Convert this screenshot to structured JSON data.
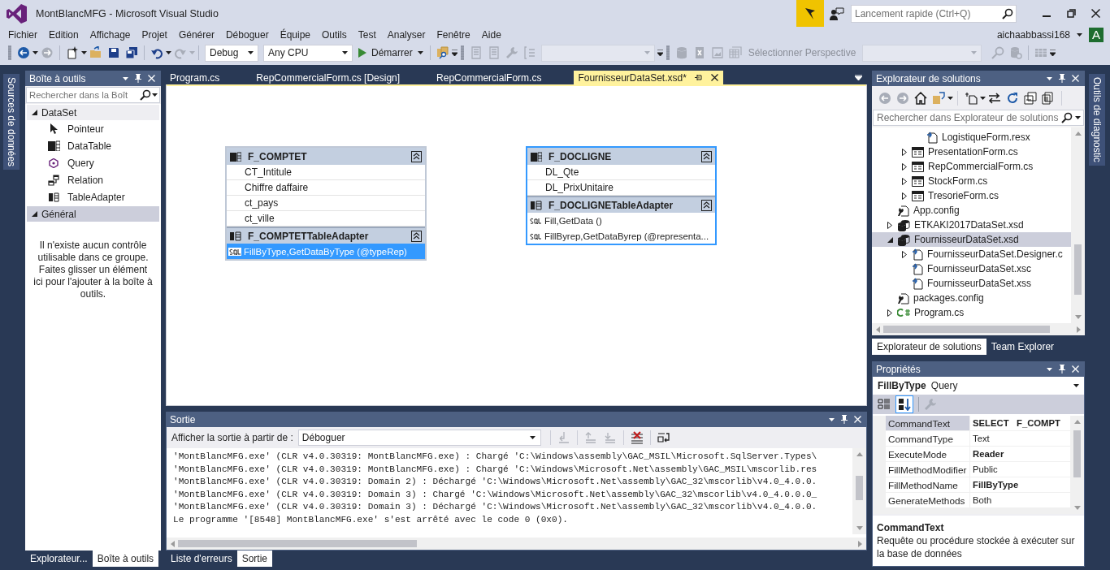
{
  "window": {
    "title": "MontBlancMFG - Microsoft Visual Studio"
  },
  "quick_launch": {
    "placeholder": "Lancement rapide (Ctrl+Q)"
  },
  "menu": [
    "Fichier",
    "Edition",
    "Affichage",
    "Projet",
    "Générer",
    "Déboguer",
    "Équipe",
    "Outils",
    "Test",
    "Analyser",
    "Fenêtre",
    "Aide"
  ],
  "account": {
    "user": "aichaabbassi168",
    "initial": "A"
  },
  "toolbar": {
    "configuration": "Debug",
    "platform": "Any CPU",
    "start": "Démarrer",
    "perspective": "Sélectionner Perspective"
  },
  "side_tabs": {
    "left": "Sources de données",
    "right": "Outils de diagnostic"
  },
  "toolbox": {
    "title": "Boîte à outils",
    "search": {
      "placeholder": "Rechercher dans la Boît"
    },
    "groups": [
      {
        "label": "DataSet",
        "expanded": true,
        "selected": false,
        "items": [
          {
            "label": "Pointeur",
            "kind": "pointer"
          },
          {
            "label": "DataTable",
            "kind": "datatable"
          },
          {
            "label": "Query",
            "kind": "query"
          },
          {
            "label": "Relation",
            "kind": "relation"
          },
          {
            "label": "TableAdapter",
            "kind": "tableadapter"
          }
        ]
      },
      {
        "label": "Général",
        "expanded": true,
        "selected": true,
        "empty_message": "Il n'existe aucun contrôle utilisable dans ce groupe. Faites glisser un élément ici pour l'ajouter à la boîte à outils."
      }
    ],
    "tabs": [
      {
        "label": "Explorateur...",
        "selected": false
      },
      {
        "label": "Boîte à outils",
        "selected": true
      }
    ]
  },
  "documents": {
    "tabs": [
      {
        "label": "Program.cs",
        "selected": false
      },
      {
        "label": "RepCommercialForm.cs [Design]",
        "selected": false
      },
      {
        "label": "RepCommercialForm.cs",
        "selected": false
      },
      {
        "label": "FournisseurDataSet.xsd*",
        "selected": true
      }
    ]
  },
  "designer": {
    "tables": [
      {
        "name": "F_COMPTET",
        "selected": false,
        "columns": [
          "CT_Intitule",
          "Chiffre daffaire",
          "ct_pays",
          "ct_ville"
        ],
        "adapter": {
          "name": "F_COMPTETTableAdapter",
          "queries": [
            {
              "text": "FillByType,GetDataByType (@typeRep)",
              "selected": true
            }
          ]
        }
      },
      {
        "name": "F_DOCLIGNE",
        "selected": true,
        "columns": [
          "DL_Qte",
          "DL_PrixUnitaire"
        ],
        "adapter": {
          "name": "F_DOCLIGNETableAdapter",
          "queries": [
            {
              "text": "Fill,GetData ()",
              "selected": false
            },
            {
              "text": "FillByrep,GetDataByrep (@representa...",
              "selected": false
            }
          ]
        }
      }
    ]
  },
  "output": {
    "title": "Sortie",
    "source_label": "Afficher la sortie à partir de :",
    "source": "Déboguer",
    "lines": [
      "'MontBlancMFG.exe' (CLR v4.0.30319: MontBlancMFG.exe) : Chargé 'C:\\Windows\\assembly\\GAC_MSIL\\Microsoft.SqlServer.Types\\",
      "'MontBlancMFG.exe' (CLR v4.0.30319: MontBlancMFG.exe) : Chargé 'C:\\Windows\\Microsoft.Net\\assembly\\GAC_MSIL\\mscorlib.res",
      "'MontBlancMFG.exe' (CLR v4.0.30319: Domain 2) : Déchargé 'C:\\Windows\\Microsoft.Net\\assembly\\GAC_32\\mscorlib\\v4.0_4.0.0.",
      "'MontBlancMFG.exe' (CLR v4.0.30319: Domain 3) : Chargé 'C:\\Windows\\Microsoft.Net\\assembly\\GAC_32\\mscorlib\\v4.0_4.0.0.0_",
      "'MontBlancMFG.exe' (CLR v4.0.30319: Domain 3) : Déchargé 'C:\\Windows\\Microsoft.Net\\assembly\\GAC_32\\mscorlib\\v4.0_4.0.0.",
      "Le programme '[8548] MontBlancMFG.exe' s'est arrêté avec le code 0 (0x0)."
    ],
    "tabs": [
      {
        "label": "Liste d'erreurs",
        "selected": false
      },
      {
        "label": "Sortie",
        "selected": true
      }
    ]
  },
  "solution_explorer": {
    "title": "Explorateur de solutions",
    "search": {
      "placeholder": "Rechercher dans Explorateur de solutions"
    },
    "items": [
      {
        "children": [
          {
            "children": [
              {
                "label": "LogistiqueForm.resx",
                "kind": "file",
                "selected": false
              }
            ]
          },
          {
            "label": "PresentationForm.cs",
            "kind": "form",
            "expanded": false,
            "selected": false
          },
          {
            "label": "RepCommercialForm.cs",
            "kind": "form",
            "expanded": false,
            "selected": false
          },
          {
            "label": "StockForm.cs",
            "kind": "form",
            "expanded": false,
            "selected": false
          },
          {
            "label": "TresorieForm.cs",
            "kind": "form",
            "expanded": false,
            "selected": false
          }
        ]
      },
      {
        "label": "App.config",
        "kind": "config",
        "selected": false
      },
      {
        "label": "ETKAKI2017DataSet.xsd",
        "kind": "dataset",
        "expanded": false,
        "selected": false
      },
      {
        "label": "FournisseurDataSet.xsd",
        "kind": "dataset",
        "expanded": true,
        "selected": true,
        "children": [
          {
            "label": "FournisseurDataSet.Designer.c",
            "kind": "file",
            "expanded": false,
            "selected": false
          },
          {
            "label": "FournisseurDataSet.xsc",
            "kind": "file",
            "selected": false
          },
          {
            "label": "FournisseurDataSet.xss",
            "kind": "file",
            "selected": false
          }
        ]
      },
      {
        "label": "packages.config",
        "kind": "config",
        "selected": false
      },
      {
        "label": "Program.cs",
        "kind": "csharp",
        "expanded": false,
        "selected": false
      }
    ],
    "tabs": [
      {
        "label": "Explorateur de solutions",
        "selected": true
      },
      {
        "label": "Team Explorer",
        "selected": false
      }
    ]
  },
  "properties": {
    "title": "Propriétés",
    "object": {
      "name": "FillByType",
      "type": "Query"
    },
    "sort_buttons": [
      {
        "kind": "categorized",
        "selected": false
      },
      {
        "kind": "alphabetical",
        "selected": true
      }
    ],
    "rows": [
      {
        "name": "CommandText",
        "value": "SELECT   F_COMPT",
        "modified": true,
        "selected": true
      },
      {
        "name": "CommandType",
        "value": "Text",
        "modified": false,
        "selected": false
      },
      {
        "name": "ExecuteMode",
        "value": "Reader",
        "modified": true,
        "selected": false
      },
      {
        "name": "FillMethodModifier",
        "value": "Public",
        "modified": false,
        "selected": false
      },
      {
        "name": "FillMethodName",
        "value": "FillByType",
        "modified": true,
        "selected": false
      },
      {
        "name": "GenerateMethods",
        "value": "Both",
        "modified": false,
        "selected": false
      }
    ],
    "description": {
      "title": "CommandText",
      "text": "Requête ou procédure stockée à exécuter sur la base de données"
    }
  }
}
